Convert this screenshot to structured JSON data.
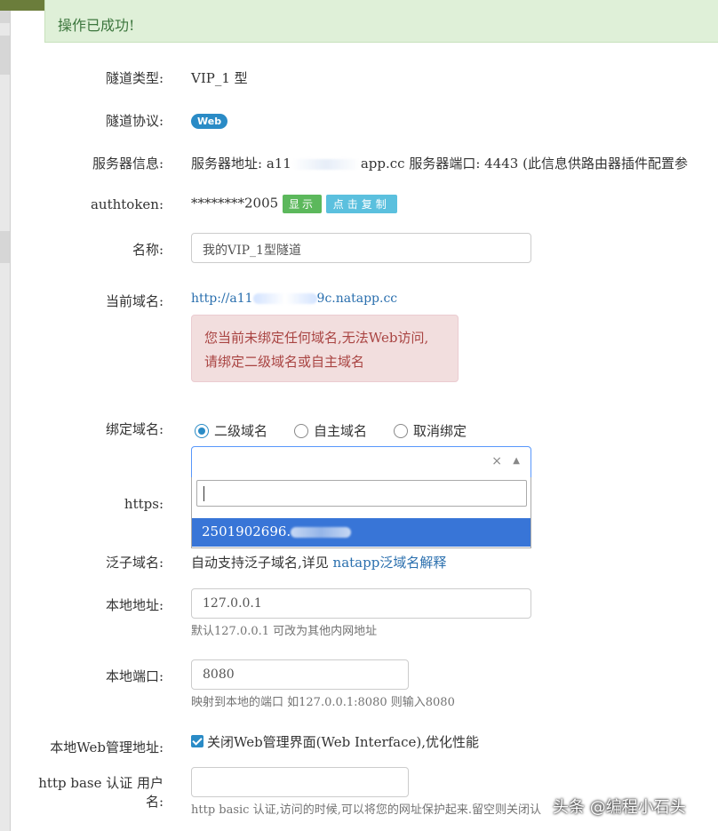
{
  "alert_success": "操作已成功!",
  "fields": {
    "tunnel_type": {
      "label": "隧道类型:",
      "value": "VIP_1 型"
    },
    "tunnel_protocol": {
      "label": "隧道协议:",
      "badge": "Web"
    },
    "server_info": {
      "label": "服务器信息:",
      "prefix": "服务器地址: a11",
      "suffix": "app.cc 服务器端口: 4443 (此信息供路由器插件配置参"
    },
    "authtoken": {
      "label": "authtoken:",
      "value": "********2005",
      "show_button": "显示",
      "copy_button": "点击复制"
    },
    "name": {
      "label": "名称:",
      "value": "我的VIP_1型隧道"
    },
    "current_domain": {
      "label": "当前域名:",
      "link_prefix": "http://a11",
      "link_suffix": "9c.natapp.cc",
      "warning_line1": "您当前未绑定任何域名,无法Web访问,",
      "warning_line2": "请绑定二级域名或自主域名"
    },
    "bind_domain": {
      "label": "绑定域名:",
      "options": [
        "二级域名",
        "自主域名",
        "取消绑定"
      ],
      "selected": "二级域名",
      "select_value": "",
      "clear_symbol": "×",
      "dropdown_option": "2501902696."
    },
    "https": {
      "label": "https:"
    },
    "wildcard_domain": {
      "label": "泛子域名:",
      "text": "自动支持泛子域名,详见 ",
      "link": "natapp泛域名解释"
    },
    "local_address": {
      "label": "本地地址:",
      "value": "127.0.0.1",
      "help": "默认127.0.0.1 可改为其他内网地址"
    },
    "local_port": {
      "label": "本地端口:",
      "value": "8080",
      "help": "映射到本地的端口 如127.0.0.1:8080 则输入8080"
    },
    "local_web_admin": {
      "label": "本地Web管理地址:",
      "checkbox_label": "关闭Web管理界面(Web Interface),优化性能",
      "checked": true
    },
    "http_basic_user": {
      "label_line1": "http base 认证 用户",
      "label_line2": "名:",
      "value": "",
      "help": "http basic 认证,访问的时候,可以将您的网址保护起来.留空则关闭认"
    }
  },
  "watermark": "头条 @编程小石头",
  "colors": {
    "accent": "#2a8bc6",
    "success_bg": "#dff0d8",
    "danger_bg": "#f2dede",
    "highlight": "#3875d7"
  }
}
